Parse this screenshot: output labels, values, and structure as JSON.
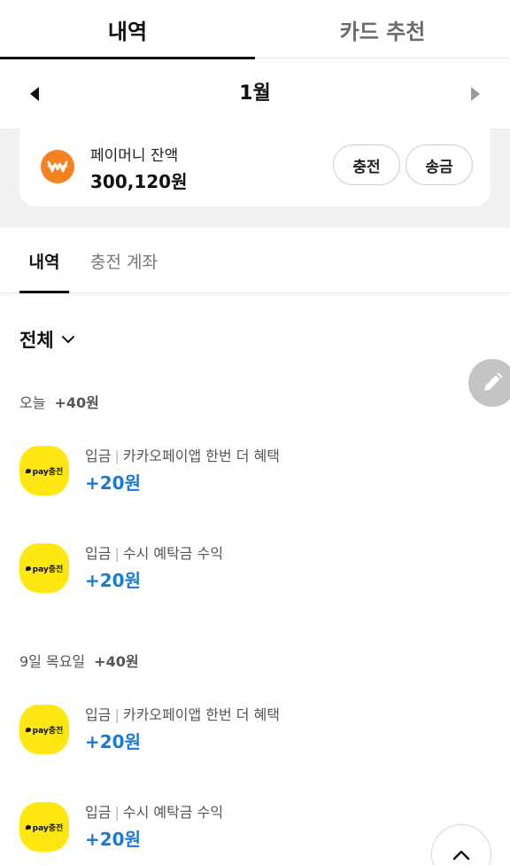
{
  "top_tabs": [
    {
      "label": "내역",
      "active": true
    },
    {
      "label": "카드 추천",
      "active": false
    }
  ],
  "month_nav": {
    "label": "1월"
  },
  "balance": {
    "label": "페이머니 잔액",
    "value": "300,120원",
    "charge_label": "충전",
    "send_label": "송금",
    "icon_color": "#f58220"
  },
  "sub_tabs": [
    {
      "label": "내역",
      "active": true
    },
    {
      "label": "충전 계좌",
      "active": false
    }
  ],
  "filter": {
    "label": "전체"
  },
  "groups": [
    {
      "date": "오늘",
      "total": "+40원",
      "items": [
        {
          "type": "입금",
          "title": "카카오페이앱 한번 더 혜택",
          "amount": "+20원",
          "icon_text": "pay충전"
        },
        {
          "type": "입금",
          "title": "수시 예탁금 수익",
          "amount": "+20원",
          "icon_text": "pay충전"
        }
      ]
    },
    {
      "date": "9일 목요일",
      "total": "+40원",
      "items": [
        {
          "type": "입금",
          "title": "카카오페이앱 한번 더 혜택",
          "amount": "+20원",
          "icon_text": "pay충전"
        },
        {
          "type": "입금",
          "title": "수시 예탁금 수익",
          "amount": "+20원",
          "icon_text": "pay충전"
        }
      ]
    }
  ],
  "colors": {
    "accent_blue": "#1a7ad6",
    "pay_yellow": "#ffe812",
    "edit_button": "#c4c4c4"
  }
}
